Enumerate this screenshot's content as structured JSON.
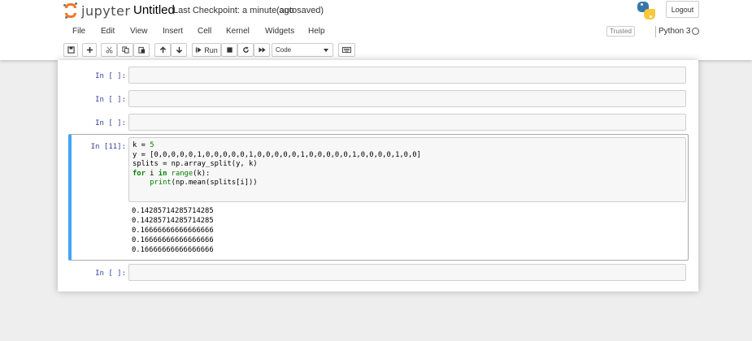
{
  "header": {
    "brand": "jupyter",
    "notebook_name": "Untitled",
    "checkpoint": "Last Checkpoint: a minute ago",
    "autosave": "(autosaved)",
    "logout_label": "Logout"
  },
  "menu": {
    "items": [
      "File",
      "Edit",
      "View",
      "Insert",
      "Cell",
      "Kernel",
      "Widgets",
      "Help"
    ],
    "trusted": "Trusted",
    "kernel": "Python 3"
  },
  "toolbar": {
    "run_label": "Run",
    "cell_type": "Code"
  },
  "cells": [
    {
      "prompt": "In [ ]:"
    },
    {
      "prompt": "In [ ]:"
    },
    {
      "prompt": "In [ ]:"
    },
    {
      "prompt": "In [11]:",
      "code_lines": [
        "k = 5",
        "y = [0,0,0,0,0,1,0,0,0,0,0,1,0,0,0,0,0,1,0,0,0,0,0,1,0,0,0,0,1,0,0]",
        "splits = np.array_split(y, k)",
        "for i in range(k):",
        "    print(np.mean(splits[i]))"
      ],
      "outputs": [
        "0.14285714285714285",
        "0.14285714285714285",
        "0.16666666666666666",
        "0.16666666666666666",
        "0.16666666666666666"
      ]
    },
    {
      "prompt": "In [ ]:"
    }
  ],
  "colors": {
    "accent_selected": "#42a5f5",
    "prompt": "#303f9f",
    "logo_orange": "#f37726",
    "keyword": "#008000"
  }
}
